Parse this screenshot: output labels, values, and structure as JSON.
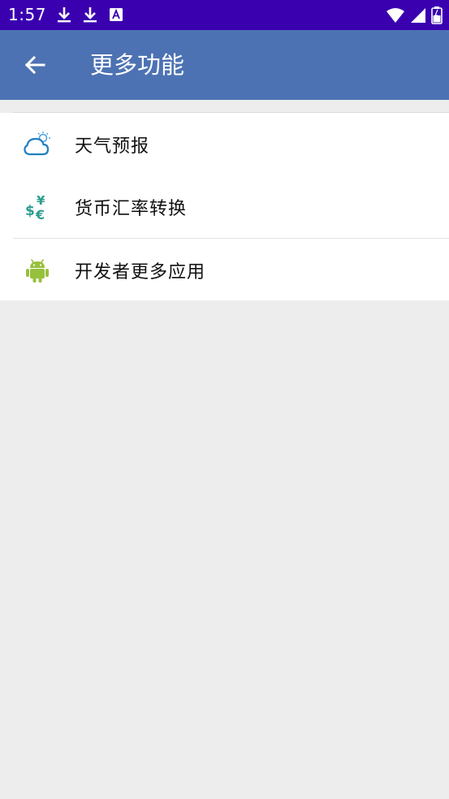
{
  "status_bar": {
    "time": "1:57",
    "left_icons": [
      "download-icon",
      "download-icon",
      "text-a-icon"
    ],
    "right_icons": [
      "wifi-icon",
      "signal-icon",
      "battery-icon"
    ]
  },
  "app_bar": {
    "title": "更多功能",
    "back_icon": "arrow-left-icon",
    "color": "#4d72b3"
  },
  "menu": {
    "items": [
      {
        "label": "天气预报",
        "icon": "weather-cloud-icon"
      },
      {
        "label": "货币汇率转换",
        "icon": "currency-exchange-icon"
      },
      {
        "label": "开发者更多应用",
        "icon": "android-icon"
      }
    ]
  },
  "colors": {
    "status_bar": "#3a00b0",
    "background": "#ededed",
    "weather_icon": "#1f7fc1",
    "currency_icon": "#2a9d8f",
    "android_icon": "#97c03d"
  }
}
